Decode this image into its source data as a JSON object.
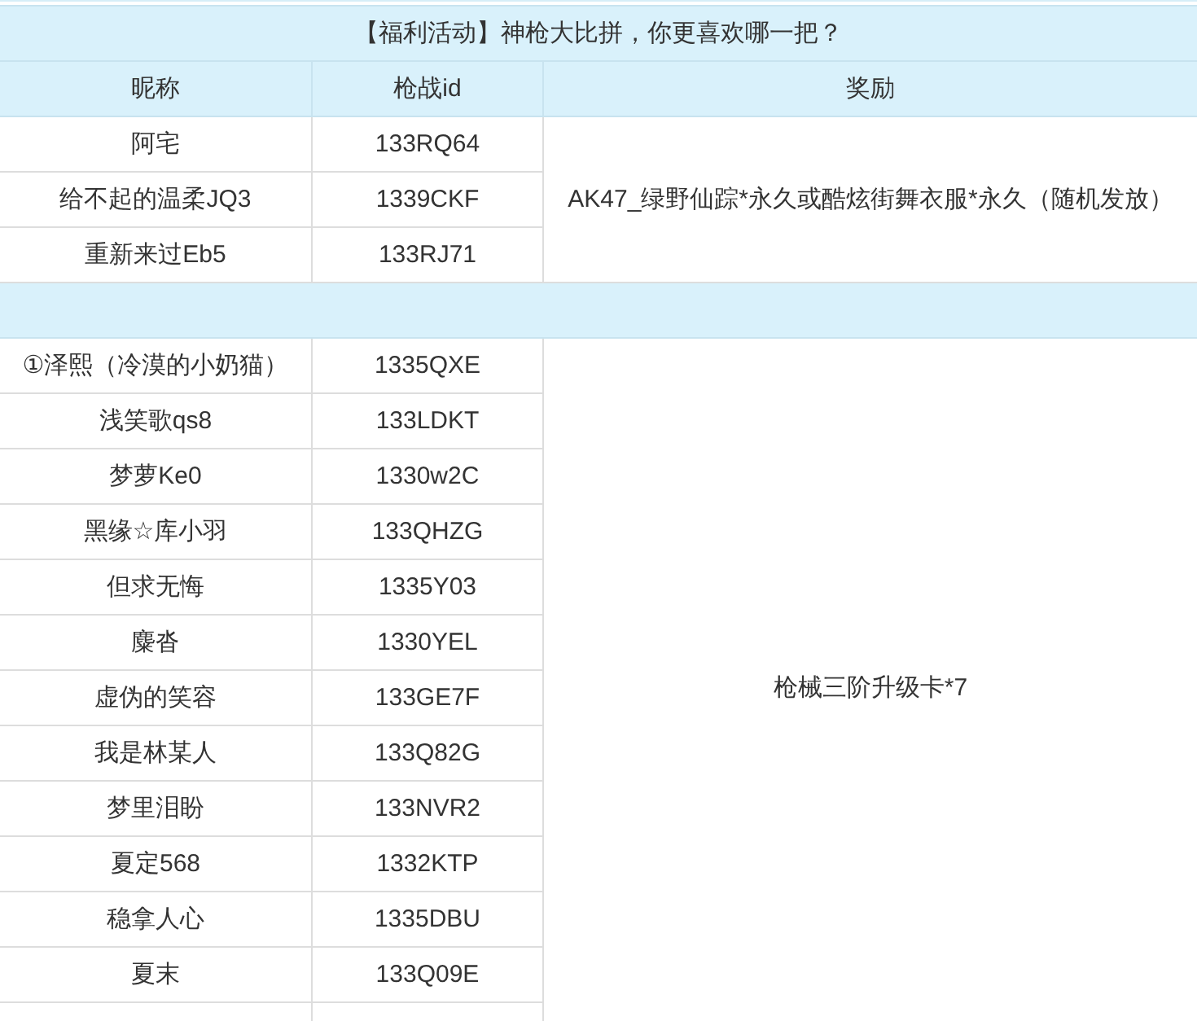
{
  "title": "【福利活动】神枪大比拼，你更喜欢哪一把？",
  "columns": [
    "昵称",
    "枪战id",
    "奖励"
  ],
  "groups": [
    {
      "reward": "AK47_绿野仙踪*永久或酷炫街舞衣服*永久（随机发放）",
      "rows": [
        {
          "nickname": "阿宅",
          "id": "133RQ64"
        },
        {
          "nickname": "给不起的温柔JQ3",
          "id": "1339CKF"
        },
        {
          "nickname": "重新来过Eb5",
          "id": "133RJ71"
        }
      ]
    },
    {
      "reward": "枪械三阶升级卡*7",
      "rows": [
        {
          "nickname": "①泽熙（冷漠的小奶猫）",
          "id": "1335QXE"
        },
        {
          "nickname": "浅笑歌qs8",
          "id": "133LDKT"
        },
        {
          "nickname": "梦萝Ke0",
          "id": "1330w2C"
        },
        {
          "nickname": "黑缘☆库小羽",
          "id": "133QHZG"
        },
        {
          "nickname": "但求无悔",
          "id": "1335Y03"
        },
        {
          "nickname": "麋沓",
          "id": "1330YEL"
        },
        {
          "nickname": "虚伪的笑容",
          "id": "133GE7F"
        },
        {
          "nickname": "我是林某人",
          "id": "133Q82G"
        },
        {
          "nickname": "梦里泪盼",
          "id": "133NVR2"
        },
        {
          "nickname": "夏定568",
          "id": "1332KTP"
        },
        {
          "nickname": "稳拿人心",
          "id": "1335DBU"
        },
        {
          "nickname": "夏末",
          "id": "133Q09E"
        }
      ]
    }
  ]
}
